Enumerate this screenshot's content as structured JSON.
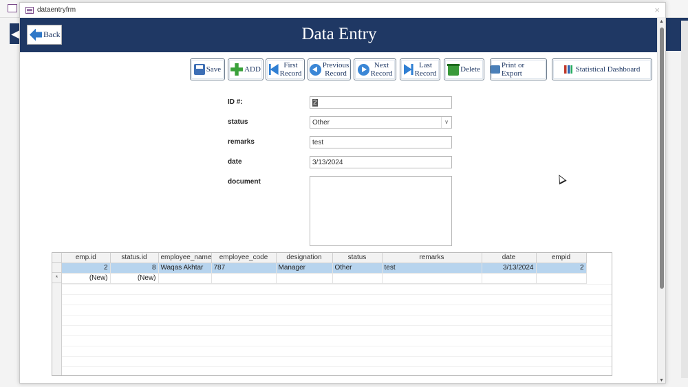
{
  "window": {
    "title": "dataentryfrm",
    "close_glyph": "×"
  },
  "header": {
    "title": "Data Entry",
    "back_label": "Back"
  },
  "toolbar": {
    "save": "Save",
    "add": "ADD",
    "first_l1": "First",
    "first_l2": "Record",
    "prev_l1": "Previous",
    "prev_l2": "Record",
    "next_l1": "Next",
    "next_l2": "Record",
    "last_l1": "Last",
    "last_l2": "Record",
    "delete": "Delete",
    "print": "Print or Export",
    "dashboard": "Statistical Dashboard"
  },
  "form": {
    "id_label": "ID #:",
    "id_value": "2",
    "status_label": "status",
    "status_value": "Other",
    "remarks_label": "remarks",
    "remarks_value": "test",
    "date_label": "date",
    "date_value": "3/13/2024",
    "document_label": "document"
  },
  "grid": {
    "columns": [
      "emp.id",
      "status.id",
      "employee_name",
      "employee_code",
      "designation",
      "status",
      "remarks",
      "date",
      "empid"
    ],
    "row": {
      "emp_id": "2",
      "status_id": "8",
      "employee_name": "Waqas Akhtar",
      "employee_code": "787",
      "designation": "Manager",
      "status": "Other",
      "remarks": "test",
      "date": "3/13/2024",
      "empid": "2"
    },
    "new_row": {
      "marker": "*",
      "emp_id": "(New)",
      "status_id": "(New)"
    }
  },
  "icons": {
    "save": "save-icon",
    "add": "plus-icon",
    "first": "first-record-icon",
    "prev": "previous-record-icon",
    "next": "next-record-icon",
    "last": "last-record-icon",
    "delete": "trash-icon",
    "print": "printer-icon",
    "dashboard": "bar-chart-icon",
    "back": "back-arrow-icon"
  },
  "colors": {
    "header_bg": "#1f3864",
    "selected_row": "#b7d4ee"
  }
}
